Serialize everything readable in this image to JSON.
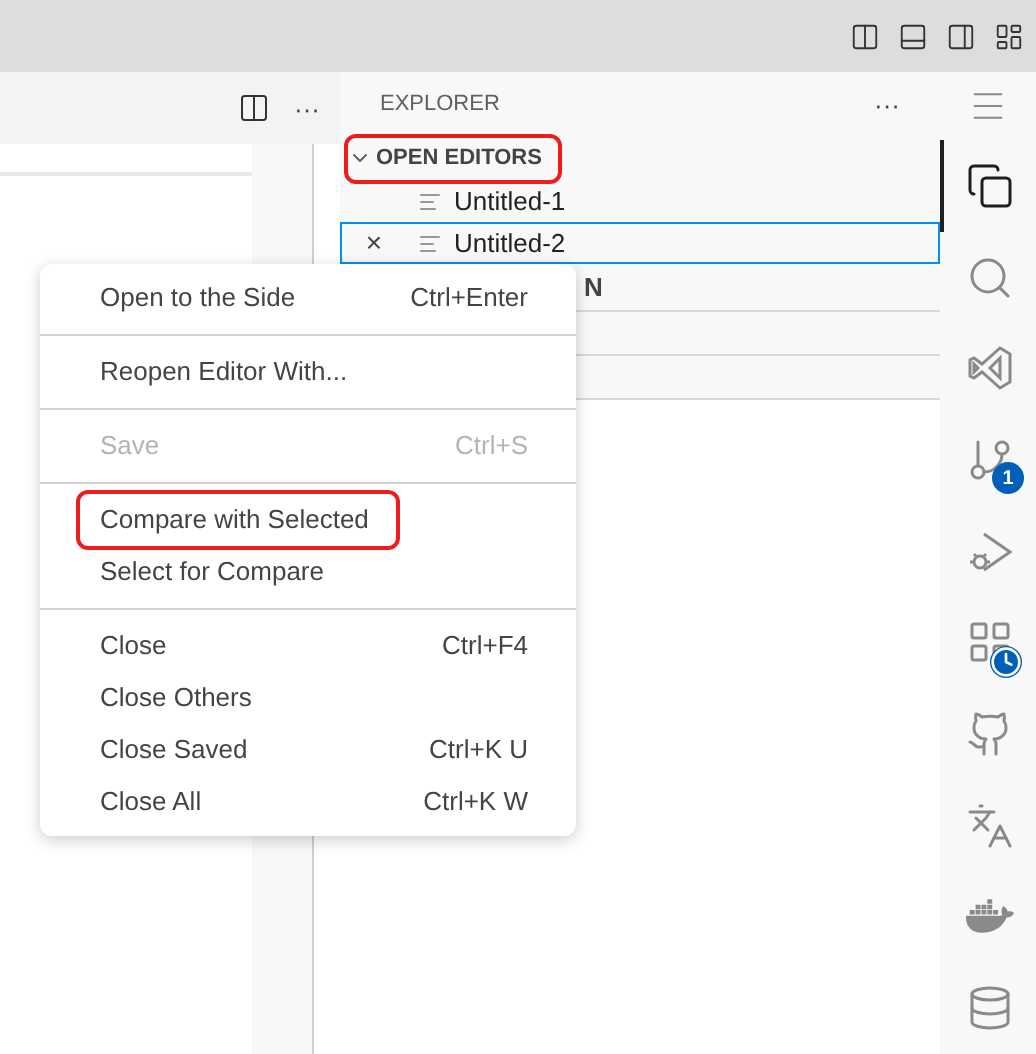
{
  "editor": {
    "more": "···"
  },
  "explorer": {
    "title": "EXPLORER",
    "more": "···",
    "sections": [
      {
        "title": "OPEN EDITORS",
        "expanded": true,
        "highlighted": true,
        "items": [
          {
            "label": "Untitled-1",
            "focused": false
          },
          {
            "label": "Untitled-2",
            "focused": true,
            "close": "×"
          }
        ]
      }
    ],
    "next_section_fragment": "N"
  },
  "activity_bar": [
    {
      "kind": "files",
      "selected": true
    },
    {
      "kind": "search",
      "selected": false
    },
    {
      "kind": "vs",
      "selected": false
    },
    {
      "kind": "git",
      "selected": false,
      "badge": "1"
    },
    {
      "kind": "debug",
      "selected": false
    },
    {
      "kind": "extensions",
      "selected": false
    },
    {
      "kind": "github",
      "selected": false
    },
    {
      "kind": "translate",
      "selected": false
    },
    {
      "kind": "docker",
      "selected": false
    },
    {
      "kind": "database",
      "selected": false
    }
  ],
  "context_menu": [
    {
      "kind": "item",
      "label": "Open to the Side",
      "shortcut": "Ctrl+Enter",
      "disabled": false,
      "highlighted": false
    },
    {
      "kind": "separator"
    },
    {
      "kind": "item",
      "label": "Reopen Editor With...",
      "disabled": false,
      "highlighted": false
    },
    {
      "kind": "separator"
    },
    {
      "kind": "item",
      "label": "Save",
      "shortcut": "Ctrl+S",
      "disabled": true,
      "highlighted": false
    },
    {
      "kind": "separator"
    },
    {
      "kind": "item",
      "label": "Compare with Selected",
      "disabled": false,
      "highlighted": true
    },
    {
      "kind": "item",
      "label": "Select for Compare",
      "disabled": false,
      "highlighted": false
    },
    {
      "kind": "separator"
    },
    {
      "kind": "item",
      "label": "Close",
      "shortcut": "Ctrl+F4",
      "disabled": false,
      "highlighted": false
    },
    {
      "kind": "item",
      "label": "Close Others",
      "disabled": false,
      "highlighted": false
    },
    {
      "kind": "item",
      "label": "Close Saved",
      "shortcut": "Ctrl+K U",
      "disabled": false,
      "highlighted": false
    },
    {
      "kind": "item",
      "label": "Close All",
      "shortcut": "Ctrl+K W",
      "disabled": false,
      "highlighted": false
    }
  ]
}
